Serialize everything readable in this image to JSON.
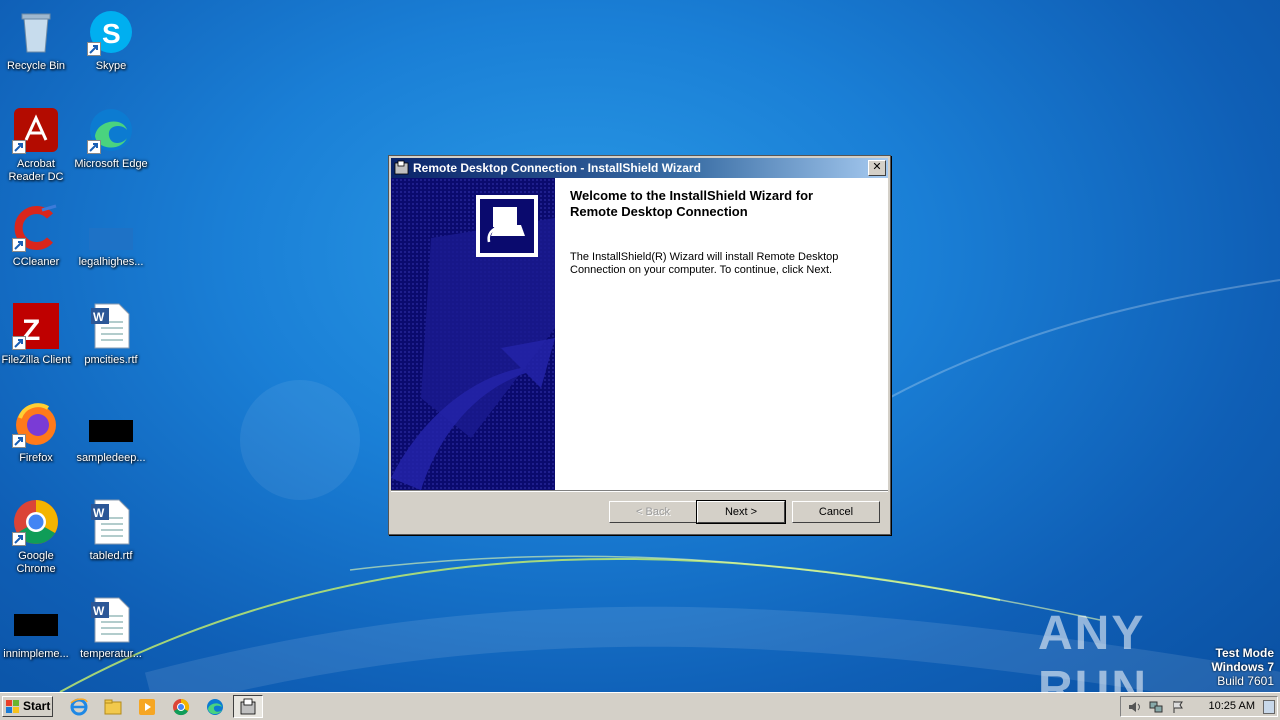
{
  "desktop": {
    "icons": [
      {
        "label": "Recycle Bin",
        "icon": "recycle-bin-icon"
      },
      {
        "label": "Skype",
        "icon": "skype-icon"
      },
      {
        "label": "Acrobat Reader DC",
        "icon": "acrobat-icon"
      },
      {
        "label": "Microsoft Edge",
        "icon": "edge-icon"
      },
      {
        "label": "CCleaner",
        "icon": "ccleaner-icon"
      },
      {
        "label": "legalhighes...",
        "icon": "blank-file-icon"
      },
      {
        "label": "FileZilla Client",
        "icon": "filezilla-icon"
      },
      {
        "label": "pmcities.rtf",
        "icon": "word-doc-icon"
      },
      {
        "label": "Firefox",
        "icon": "firefox-icon"
      },
      {
        "label": "sampledeep...",
        "icon": "black-file-icon"
      },
      {
        "label": "Google Chrome",
        "icon": "chrome-icon"
      },
      {
        "label": "tabled.rtf",
        "icon": "word-doc-icon"
      },
      {
        "label": "innimpleme...",
        "icon": "black-file-icon"
      },
      {
        "label": "temperatur...",
        "icon": "word-doc-icon"
      }
    ]
  },
  "watermark": {
    "brand": "ANY RUN",
    "line1": "Test Mode",
    "line2": "Windows 7",
    "line3": "Build 7601"
  },
  "dialog": {
    "title": "Remote Desktop Connection - InstallShield Wizard",
    "heading_line1": "Welcome to the InstallShield Wizard for",
    "heading_line2": "Remote Desktop Connection",
    "body_line1": "The InstallShield(R) Wizard will install Remote Desktop",
    "body_line2": "Connection on your computer. To continue, click Next.",
    "back_label": "< Back",
    "next_label": "Next >",
    "cancel_label": "Cancel",
    "close_label": "✕"
  },
  "taskbar": {
    "start_label": "Start",
    "clock": "10:25 AM",
    "pinned": [
      "internet-explorer-icon",
      "explorer-icon",
      "media-player-icon",
      "chrome-icon",
      "edge-icon",
      "installer-icon"
    ]
  },
  "colors": {
    "title_active": "#0a246a",
    "banner": "#0a0a6e",
    "face": "#d4d0c8"
  }
}
